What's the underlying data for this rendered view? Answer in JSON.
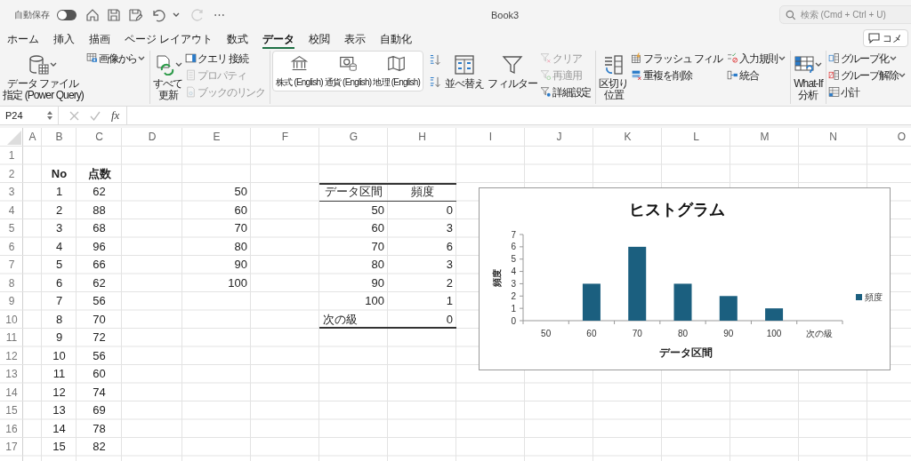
{
  "top_bar": {
    "autosave_label": "自動保存",
    "autosave_on": false,
    "redo": {
      "disabled": true
    },
    "more": "⋯",
    "title": "Book3",
    "search": {
      "placeholder": "検索 (Cmd + Ctrl + U)"
    }
  },
  "tabs": [
    {
      "label": "ホーム",
      "selected": false
    },
    {
      "label": "挿入",
      "selected": false
    },
    {
      "label": "描画",
      "selected": false
    },
    {
      "label": "ページ レイアウト",
      "selected": false
    },
    {
      "label": "数式",
      "selected": false
    },
    {
      "label": "データ",
      "selected": true
    },
    {
      "label": "校閲",
      "selected": false
    },
    {
      "label": "表示",
      "selected": false
    },
    {
      "label": "自動化",
      "selected": false
    }
  ],
  "comment_button": "コメ",
  "ribbon": {
    "groups": [
      {
        "items": [
          {
            "kind": "large",
            "label": [
              "データ ファイル",
              "指定 (Power Query)"
            ],
            "caret": true
          },
          {
            "kind": "stack",
            "items": [
              {
                "label": "画像から",
                "caret": true,
                "disabled": false
              }
            ]
          }
        ]
      },
      {
        "items": [
          {
            "kind": "large",
            "label": [
              "すべて",
              "更新"
            ],
            "caret": true
          },
          {
            "kind": "stack",
            "items": [
              {
                "label": "クエリ 接続",
                "caret": false,
                "disabled": false
              },
              {
                "label": "プロパティ",
                "caret": false,
                "disabled": true
              },
              {
                "label": "ブックのリンク",
                "caret": false,
                "disabled": true
              }
            ]
          }
        ]
      },
      {
        "items": [
          {
            "kind": "types",
            "items": [
              {
                "label": "株式 (English)"
              },
              {
                "label": "通貨 (English)"
              },
              {
                "label": "地理 (English)"
              }
            ]
          }
        ]
      },
      {
        "items": [
          {
            "kind": "sort_buttons"
          },
          {
            "kind": "large",
            "label": [
              "並べ替え"
            ],
            "caret": false
          },
          {
            "kind": "large",
            "label": [
              "フィルター"
            ],
            "caret": false
          },
          {
            "kind": "stack",
            "items": [
              {
                "label": "クリア",
                "caret": false,
                "disabled": true
              },
              {
                "label": "再適用",
                "caret": false,
                "disabled": true
              },
              {
                "label": "詳細設定",
                "caret": false,
                "disabled": false
              }
            ]
          }
        ]
      },
      {
        "items": [
          {
            "kind": "large",
            "label": [
              "区切り",
              "位置"
            ],
            "caret": false
          },
          {
            "kind": "stack",
            "items": [
              {
                "label": "フラッシュ フィル",
                "caret": false,
                "disabled": false
              },
              {
                "label": "重複を削除",
                "caret": false,
                "disabled": false
              }
            ]
          },
          {
            "kind": "stack",
            "items": [
              {
                "label": "入力規則",
                "caret": true,
                "disabled": false
              },
              {
                "label": "統合",
                "caret": false,
                "disabled": false
              }
            ]
          }
        ]
      },
      {
        "items": [
          {
            "kind": "large",
            "label": [
              "What-If",
              "分析"
            ],
            "caret": true
          }
        ]
      },
      {
        "items": [
          {
            "kind": "stack",
            "items": [
              {
                "label": "グループ化",
                "caret": true,
                "disabled": false
              },
              {
                "label": "グループ解除",
                "caret": true,
                "disabled": false
              },
              {
                "label": "小計",
                "caret": false,
                "disabled": false
              }
            ]
          }
        ]
      }
    ]
  },
  "formula_bar": {
    "name_box": "P24",
    "function_label": "fx"
  },
  "sheet": {
    "columns": [
      "A",
      "B",
      "C",
      "D",
      "E",
      "F",
      "G",
      "H",
      "I",
      "J",
      "K",
      "L",
      "M",
      "N",
      "O"
    ],
    "row_numbers": [
      "1",
      "2",
      "3",
      "4",
      "5",
      "6",
      "7",
      "8",
      "9",
      "10",
      "11",
      "12",
      "13",
      "14",
      "15",
      "16",
      "17"
    ],
    "scores": {
      "columns": [
        "No",
        "点数"
      ],
      "rows": [
        [
          "1",
          "62"
        ],
        [
          "2",
          "88"
        ],
        [
          "3",
          "68"
        ],
        [
          "4",
          "96"
        ],
        [
          "5",
          "66"
        ],
        [
          "6",
          "62"
        ],
        [
          "7",
          "56"
        ],
        [
          "8",
          "70"
        ],
        [
          "9",
          "72"
        ],
        [
          "10",
          "56"
        ],
        [
          "11",
          "60"
        ],
        [
          "12",
          "74"
        ],
        [
          "13",
          "69"
        ],
        [
          "14",
          "78"
        ],
        [
          "15",
          "82"
        ]
      ]
    },
    "bins": [
      "50",
      "60",
      "70",
      "80",
      "90",
      "100"
    ],
    "frequency_table": {
      "columns": [
        "データ区間",
        "頻度"
      ],
      "rows": [
        {
          "kind": "value",
          "bin": "50",
          "count": "0"
        },
        {
          "kind": "value",
          "bin": "60",
          "count": "3"
        },
        {
          "kind": "value",
          "bin": "70",
          "count": "6"
        },
        {
          "kind": "value",
          "bin": "80",
          "count": "3"
        },
        {
          "kind": "value",
          "bin": "90",
          "count": "2"
        },
        {
          "kind": "value",
          "bin": "100",
          "count": "1"
        },
        {
          "kind": "label",
          "bin": "次の級",
          "count": "0"
        }
      ]
    },
    "chart": {
      "chart_data": {
        "type": "bar",
        "title": "ヒストグラム",
        "xlabel": "データ区間",
        "ylabel": "頻度",
        "categories": [
          "50",
          "60",
          "70",
          "80",
          "90",
          "100",
          "次の級"
        ],
        "series": [
          {
            "name": "頻度",
            "color": "#1b5f7f",
            "values": [
              0,
              3,
              6,
              3,
              2,
              1,
              0
            ]
          }
        ],
        "ylim": [
          0,
          7
        ],
        "yticks": [
          0,
          1,
          2,
          3,
          4,
          5,
          6,
          7
        ]
      }
    }
  }
}
